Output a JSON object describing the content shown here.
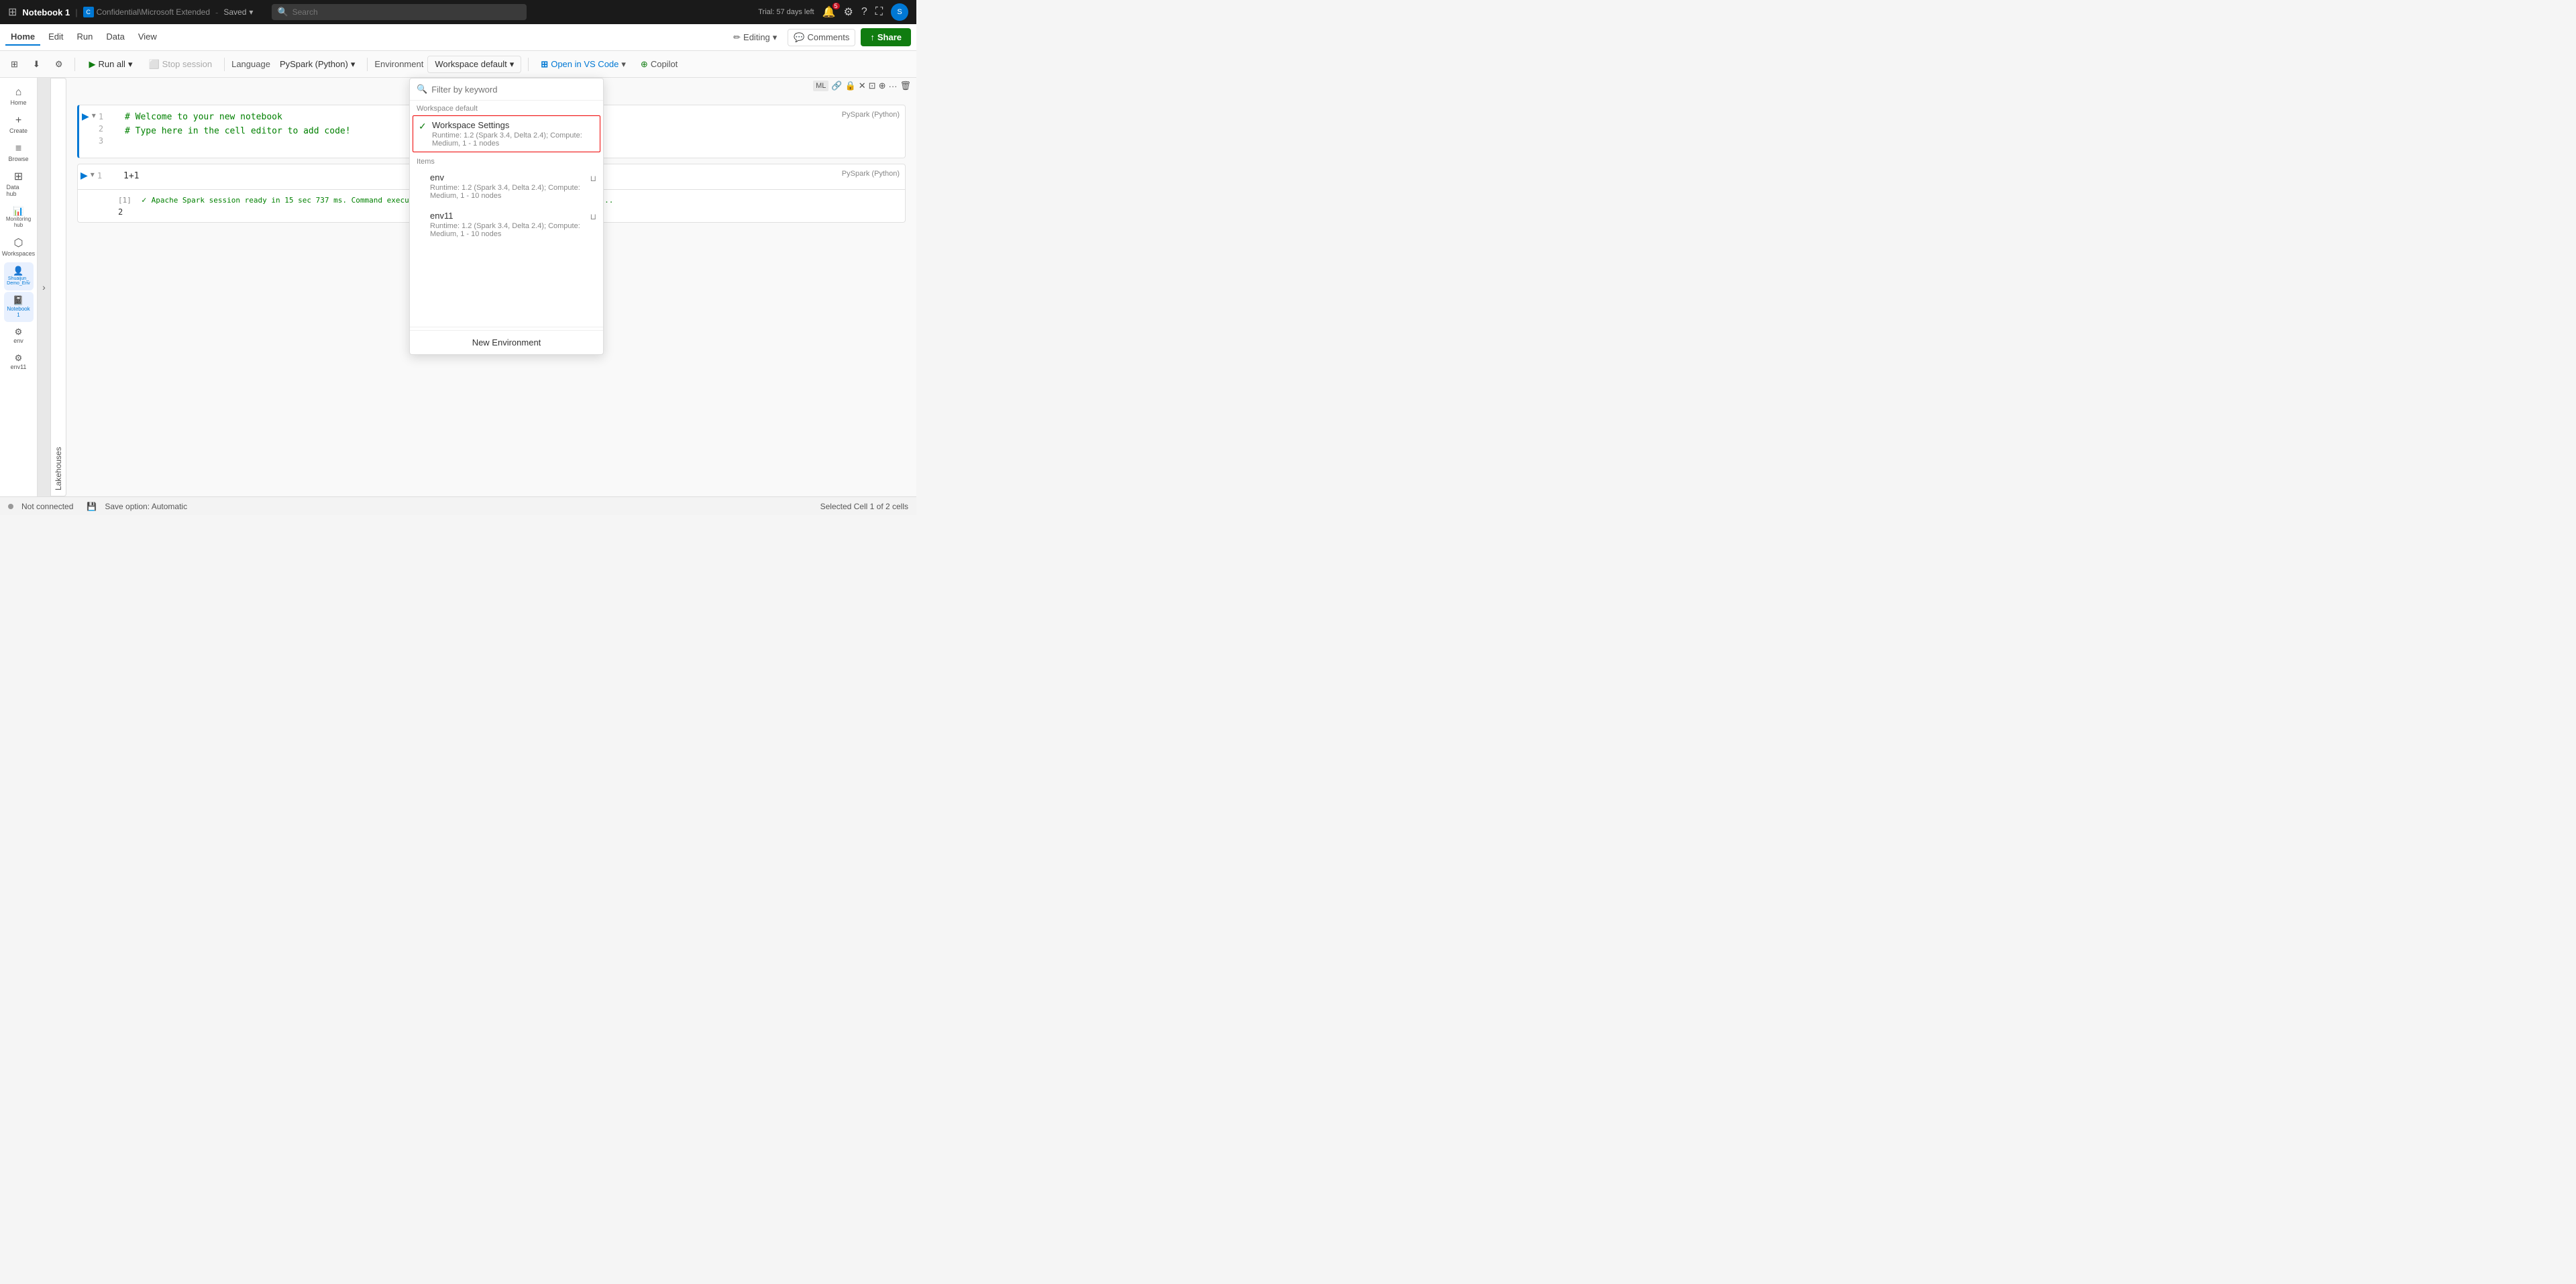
{
  "topbar": {
    "notebook_name": "Notebook 1",
    "workspace_label": "Confidential\\Microsoft Extended",
    "saved_label": "Saved",
    "search_placeholder": "Search",
    "trial_text": "Trial: 57 days left",
    "notifications_count": "5"
  },
  "menu": {
    "home_label": "Home",
    "edit_label": "Edit",
    "run_label": "Run",
    "data_label": "Data",
    "view_label": "View"
  },
  "toolbar": {
    "editing_label": "Editing",
    "comments_label": "Comments",
    "share_label": "Share"
  },
  "actionbar": {
    "run_all_label": "Run all",
    "stop_session_label": "Stop session",
    "language_label": "Language",
    "language_value": "PySpark (Python)",
    "environment_label": "Environment",
    "workspace_label": "Workspace default",
    "open_vs_code_label": "Open in VS Code",
    "copilot_label": "Copilot"
  },
  "sidebar": {
    "items": [
      {
        "icon": "⌂",
        "label": "Home"
      },
      {
        "icon": "+",
        "label": "Create"
      },
      {
        "icon": "≡",
        "label": "Browse"
      },
      {
        "icon": "⊞",
        "label": "Data hub"
      },
      {
        "icon": "📊",
        "label": "Monitoring hub"
      },
      {
        "icon": "⬡",
        "label": "Workspaces"
      },
      {
        "icon": "👤",
        "label": "Shuaijun_Demo_Env",
        "active": true
      },
      {
        "icon": "📓",
        "label": "Notebook 1",
        "active": true
      },
      {
        "icon": "⚙",
        "label": "env"
      },
      {
        "icon": "⚙",
        "label": "env11"
      }
    ],
    "lakehouses_label": "Lakehouses"
  },
  "notebook": {
    "cell_toolbar_actions": [
      "ML",
      "🔗",
      "🔒",
      "✕",
      "⊡",
      "⊕",
      "…",
      "🗑"
    ],
    "cell1": {
      "line_numbers": [
        "1",
        "2",
        "3"
      ],
      "lines": [
        "# Welcome to your new notebook",
        "# Type here in the cell editor to add code!",
        ""
      ],
      "language": "PySpark (Python)"
    },
    "cell2": {
      "line_numbers": [
        "1"
      ],
      "code": "1+1",
      "output_label": "[1]",
      "output_check": "✓",
      "output_text": "Apache Spark session ready in 15 sec 737 ms. Command executed in 2 sec 917 ms by Shuaijun Ye on 4:59:...",
      "output_line": "2",
      "language": "PySpark (Python)"
    }
  },
  "dropdown": {
    "filter_placeholder": "Filter by keyword",
    "workspace_section_label": "Workspace default",
    "selected_item": {
      "name": "Workspace Settings",
      "desc": "Runtime: 1.2 (Spark 3.4, Delta 2.4); Compute: Medium, 1 - 1 nodes",
      "check": "✓"
    },
    "items_section_label": "Items",
    "items": [
      {
        "name": "env",
        "desc": "Runtime: 1.2 (Spark 3.4, Delta 2.4); Compute: Medium, 1 - 10 nodes"
      },
      {
        "name": "env11",
        "desc": "Runtime: 1.2 (Spark 3.4, Delta 2.4); Compute: Medium, 1 - 10 nodes"
      }
    ],
    "new_env_label": "New Environment"
  },
  "statusbar": {
    "not_connected": "Not connected",
    "save_option": "Save option: Automatic",
    "selected_cell": "Selected Cell 1 of 2 cells"
  }
}
